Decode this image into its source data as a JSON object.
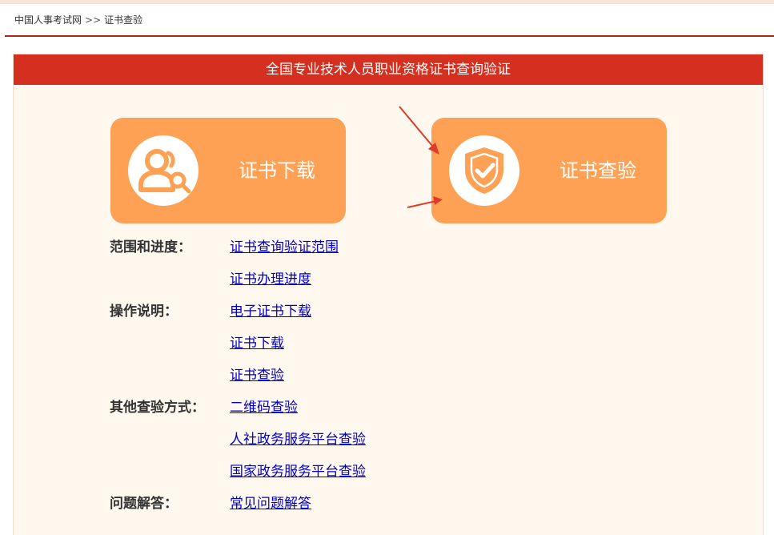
{
  "breadcrumb": {
    "home": "中国人事考试网",
    "separator": ">>",
    "current": "证书查验"
  },
  "panel": {
    "title": "全国专业技术人员职业资格证书查询验证"
  },
  "cards": {
    "download": {
      "label": "证书下载",
      "icon": "user-search-icon"
    },
    "verify": {
      "label": "证书查验",
      "icon": "shield-check-icon"
    }
  },
  "info": {
    "scope_label": "范围和进度：",
    "scope_links": [
      "证书查询验证范围",
      "证书办理进度"
    ],
    "ops_label": "操作说明：",
    "ops_links": [
      "电子证书下载",
      "证书下载",
      "证书查验"
    ],
    "other_label": "其他查验方式：",
    "other_links": [
      "二维码查验",
      "人社政务服务平台查验",
      "国家政务服务平台查验"
    ],
    "faq_label": "问题解答：",
    "faq_links": [
      "常见问题解答"
    ]
  },
  "colors": {
    "header_red": "#d5301f",
    "card_orange": "#ffa154",
    "panel_bg": "#fff8ef",
    "link_blue": "#0000cc",
    "arrow_red": "#e23a2a"
  }
}
